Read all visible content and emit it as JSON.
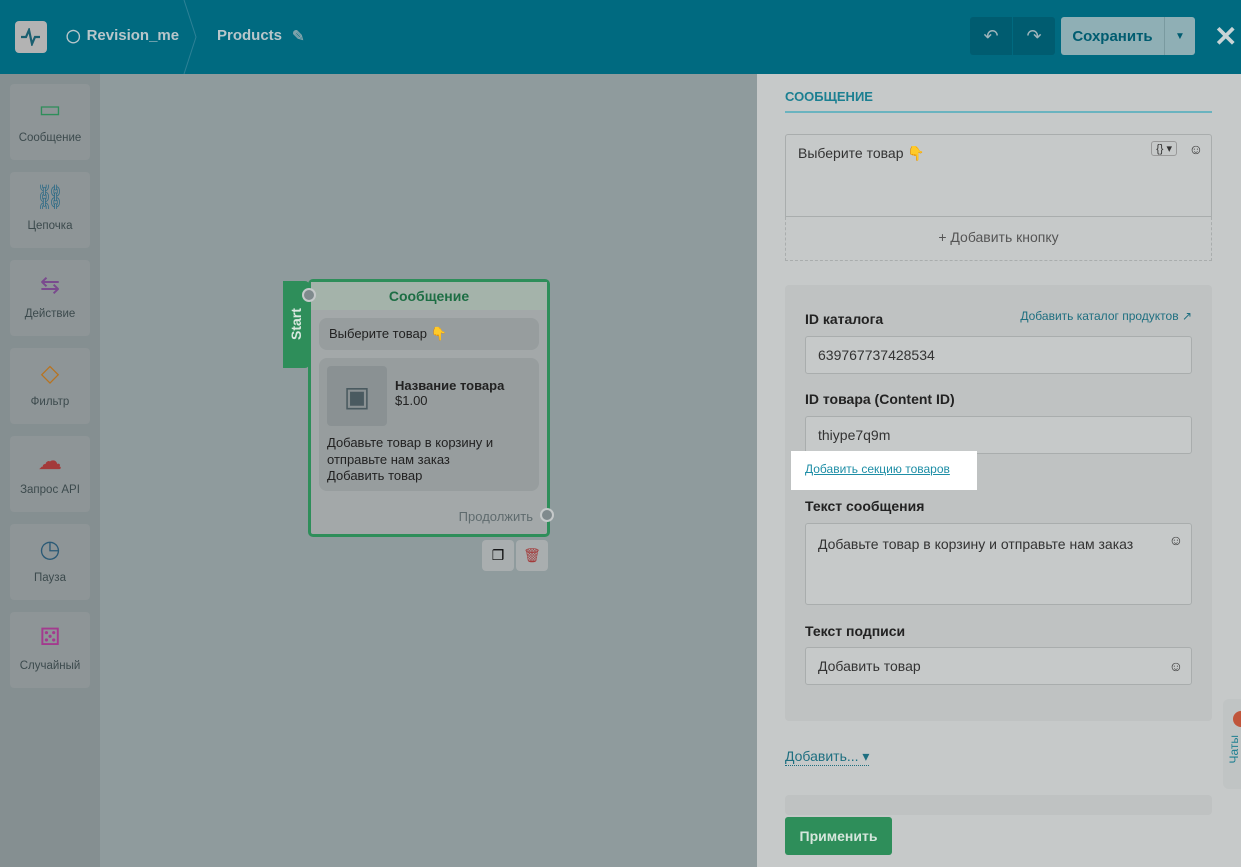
{
  "header": {
    "bot_name": "Revision_me",
    "flow_name": "Products",
    "save_label": "Сохранить",
    "close": "✕"
  },
  "sidebar": {
    "items": [
      {
        "label": "Сообщение",
        "icon": "message-icon",
        "color": "#2e8e5a"
      },
      {
        "label": "Цепочка",
        "icon": "chain-icon",
        "color": "#2b6a86"
      },
      {
        "label": "Действие",
        "icon": "action-icon",
        "color": "#7a4a8e"
      },
      {
        "label": "Фильтр",
        "icon": "filter-icon",
        "color": "#b8731f"
      },
      {
        "label": "Запрос API",
        "icon": "api-icon",
        "color": "#a33a3a"
      },
      {
        "label": "Пауза",
        "icon": "timer-icon",
        "color": "#2b5a76"
      },
      {
        "label": "Случайный",
        "icon": "dice-icon",
        "color": "#a33a8e"
      }
    ]
  },
  "node": {
    "start": "Start",
    "title": "Сообщение",
    "text": "Выберите товар 👇",
    "product_name": "Название товара",
    "price": "$1.00",
    "description": "Добавьте товар в корзину и отправьте нам заказ",
    "caption": "Добавить товар",
    "continue": "Продолжить"
  },
  "panel": {
    "section_title": "СООБЩЕНИЕ",
    "message_text": "Выберите товар 👇",
    "add_button": "+ Добавить кнопку",
    "catalog_label": "ID каталога",
    "add_catalog_link": "Добавить каталог продуктов",
    "catalog_id": "639767737428534",
    "product_label": "ID товара (Content ID)",
    "product_id": "thiype7q9m",
    "add_section_link": "Добавить секцию товаров",
    "text_label": "Текст сообщения",
    "text_value": "Добавьте товар в корзину и отправьте нам заказ",
    "caption_label": "Текст подписи",
    "caption_value": "Добавить товар",
    "add_more": "Добавить...",
    "apply": "Применить",
    "chats": "Чаты"
  }
}
